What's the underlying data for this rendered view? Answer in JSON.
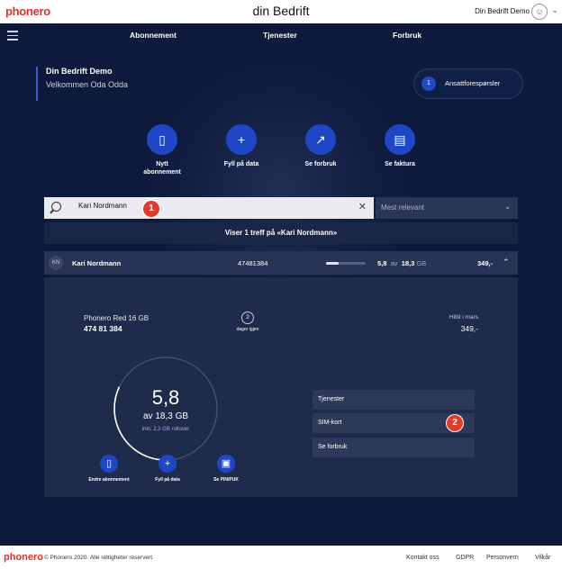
{
  "header": {
    "logo": "phonero",
    "brand": "din Bedrift",
    "account_name": "Din Bedrift Demo",
    "avatar_icon": "user-icon",
    "dropdown_icon": "chevron-down-icon"
  },
  "nav": {
    "items": [
      {
        "label": "Abonnement"
      },
      {
        "label": "Tjenester"
      },
      {
        "label": "Forbruk"
      }
    ]
  },
  "welcome": {
    "company": "Din Bedrift Demo",
    "greeting": "Velkommen Oda Odda"
  },
  "employee_requests": {
    "count": "1",
    "label": "Ansattforespørsler"
  },
  "quick_actions": [
    {
      "icon": "phone-icon",
      "label_line1": "Nytt",
      "label_line2": "abonnement"
    },
    {
      "icon": "plus-icon",
      "label_line1": "Fyll på data",
      "label_line2": ""
    },
    {
      "icon": "chart-icon",
      "label_line1": "Se forbruk",
      "label_line2": ""
    },
    {
      "icon": "invoice-icon",
      "label_line1": "Se faktura",
      "label_line2": ""
    }
  ],
  "search": {
    "value": "Kari Nordmann",
    "sort_label": "Mest relevant"
  },
  "annotations": [
    "1",
    "2"
  ],
  "results_text": "Viser 1 treff på «Kari Nordmann»",
  "subscription_row": {
    "initials": "KN",
    "name": "Kari Nordmann",
    "phone": "47481384",
    "usage_fraction": 0.32,
    "used": "5,8",
    "of_word": "av",
    "total": "18,3",
    "unit": "GB",
    "price": "349,-"
  },
  "detail": {
    "plan_name": "Phonero Red 16 GB",
    "phone_formatted": "474 81 384",
    "days_left": "2",
    "days_left_label": "dager igjen",
    "month_label": "Hittil i mars",
    "month_amount": "349,-",
    "gauge_value": "5,8",
    "gauge_of": "av 18,3 GB",
    "gauge_rollover": "inkl. 2,3 GB rollover",
    "gauge_fraction": 0.32,
    "actions": [
      {
        "icon": "phone-icon",
        "label": "Endre abonnement"
      },
      {
        "icon": "plus-icon",
        "label": "Fyll på data"
      },
      {
        "icon": "lock-icon",
        "label": "Se PIN/PUK"
      }
    ],
    "menu": [
      {
        "label": "Tjenester"
      },
      {
        "label": "SIM-kort"
      },
      {
        "label": "Se forbruk"
      }
    ]
  },
  "footer": {
    "logo": "phonero",
    "copyright": "© Phonero 2020. Alle rettigheter reservert.",
    "links": [
      {
        "label": "Kontakt oss"
      },
      {
        "label": "GDPR"
      },
      {
        "label": "Personvern"
      },
      {
        "label": "Vilkår"
      }
    ]
  },
  "colors": {
    "background": "#0e1a3c",
    "accent": "#1f46c4",
    "brand_red": "#e4322b",
    "annotation_red": "#e23b2c"
  }
}
